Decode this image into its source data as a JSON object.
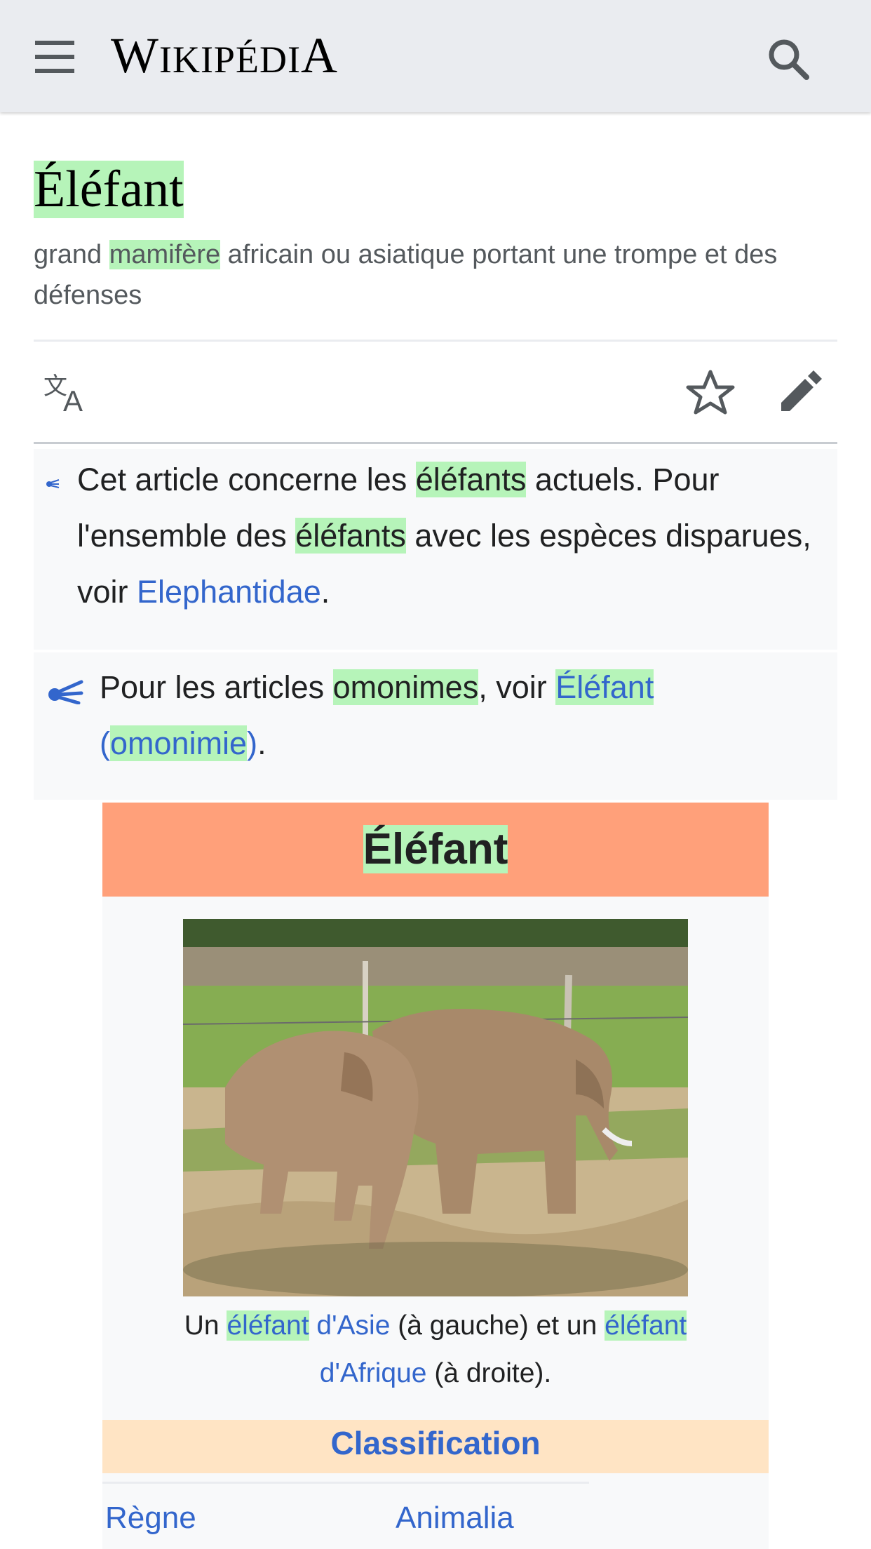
{
  "header": {
    "menu_icon": "hamburger-menu-icon",
    "logo_text": "Wikipédia",
    "logo_first": "W",
    "logo_mid": "IKIPÉDI",
    "logo_last": "A",
    "search_icon": "search-icon",
    "background": "#eaecf0"
  },
  "article": {
    "title": "Éléfant",
    "description_parts": [
      "grand ",
      "mamifère",
      " africain ou asiatique portant une trompe et des défenses"
    ]
  },
  "actions": {
    "language_icon": "translate-icon",
    "watch_icon": "star-icon",
    "edit_icon": "pencil-icon"
  },
  "hatnotes": [
    {
      "icon": "disambiguation-icon",
      "t1": "Cet article concerne les ",
      "h1": "éléfants",
      "t2": " actuels. Pour l'ensemble des ",
      "h2": "éléfants",
      "t3": " avec les espèces disparues, voir ",
      "link": "Elephantidae",
      "t4": "."
    },
    {
      "icon": "disambiguation-icon",
      "t1": "Pour les articles ",
      "h1": "omonimes",
      "t2": ", voir ",
      "link1": "Éléfant",
      "link2": " (",
      "link3": "omonimie",
      "link4": ")",
      "t3": "."
    }
  ],
  "infobox": {
    "title": "Éléfant",
    "title_bg": "#ffa07a",
    "image_alt": "elephants-photo",
    "caption": {
      "t1": "Un ",
      "l1a": "éléfant",
      "l1b": " d'Asie",
      "t2": " (à gauche) et un ",
      "l2a": "éléfant",
      "l2b": " d'Afrique",
      "t3": " (à droite)."
    },
    "classification_label": "Classification",
    "classification_bg": "#ffe4c4",
    "rows": [
      {
        "key": "Règne",
        "value": "Animalia"
      }
    ]
  },
  "colors": {
    "link": "#3366cc",
    "highlight": "#b6f4b9"
  }
}
